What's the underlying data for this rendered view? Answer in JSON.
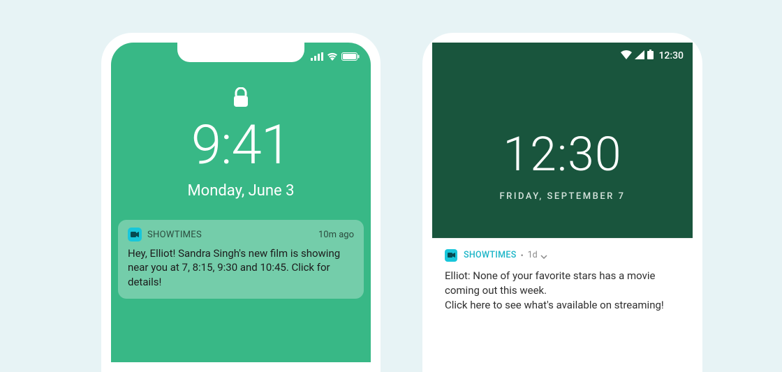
{
  "ios": {
    "time": "9:41",
    "date": "Monday, June 3",
    "notification": {
      "app_name": "SHOWTIMES",
      "ago": "10m ago",
      "body": "Hey, Elliot! Sandra Singh's new film is showing near you at 7, 8:15, 9:30 and 10:45. Click for details!"
    }
  },
  "android": {
    "status_time": "12:30",
    "time": "12:30",
    "date": "FRIDAY, SEPTEMBER 7",
    "notification": {
      "app_name": "SHOWTIMES",
      "ago": "1d",
      "body": "Elliot: None of your favorite stars has a movie coming out this week.\nClick here to see what's available on streaming!"
    }
  }
}
